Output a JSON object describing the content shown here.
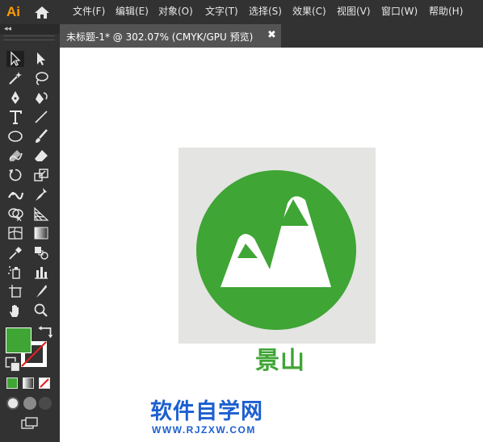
{
  "app": {
    "logo_text": "Ai",
    "accent": "#ff9a00"
  },
  "menus": [
    "文件(F)",
    "编辑(E)",
    "对象(O)",
    "文字(T)",
    "选择(S)",
    "效果(C)",
    "视图(V)",
    "窗口(W)",
    "帮助(H)"
  ],
  "document": {
    "tab_label": "未标题-1* @ 302.07% (CMYK/GPU 预览)",
    "close_glyph": "✖"
  },
  "toolbar": {
    "collapse_glyph": "◂◂",
    "tools": [
      "selection-tool-icon",
      "direct-selection-tool-icon",
      "magic-wand-tool-icon",
      "lasso-tool-icon",
      "pen-tool-icon",
      "curvature-tool-icon",
      "type-tool-icon",
      "line-segment-tool-icon",
      "ellipse-tool-icon",
      "paintbrush-tool-icon",
      "shaper-tool-icon",
      "eraser-tool-icon",
      "rotate-tool-icon",
      "scale-tool-icon",
      "width-tool-icon",
      "puppet-warp-tool-icon",
      "shape-builder-tool-icon",
      "perspective-grid-tool-icon",
      "mesh-tool-icon",
      "gradient-tool-icon",
      "eyedropper-tool-icon",
      "blend-tool-icon",
      "symbol-sprayer-tool-icon",
      "column-graph-tool-icon",
      "artboard-tool-icon",
      "slice-tool-icon",
      "hand-tool-icon",
      "zoom-tool-icon"
    ],
    "fill_color": "#3fa535",
    "stroke_color": "none"
  },
  "artwork": {
    "background": "#e4e4e2",
    "circle_color": "#3fa535",
    "mountain_color": "#ffffff",
    "caption": "景山"
  },
  "watermark": {
    "title": "软件自学网",
    "url": "WWW.RJZXW.COM",
    "color": "#1c5fd0"
  }
}
